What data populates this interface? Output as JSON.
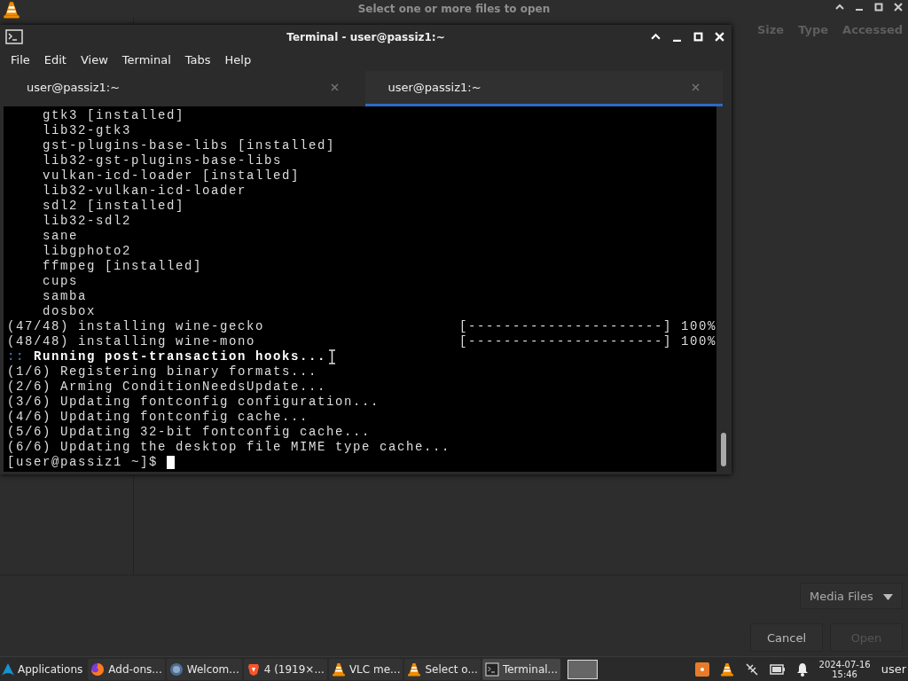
{
  "dialog": {
    "title": "Select one or more files to open",
    "columns": [
      "Size",
      "Type",
      "Accessed"
    ],
    "filter": "Media Files",
    "buttons": [
      {
        "label": "Cancel",
        "disabled": false
      },
      {
        "label": "Open",
        "disabled": true
      }
    ]
  },
  "terminal": {
    "title": "Terminal - user@passiz1:~",
    "menu": [
      "File",
      "Edit",
      "View",
      "Terminal",
      "Tabs",
      "Help"
    ],
    "tabs": [
      {
        "label": "user@passiz1:~",
        "selected": false
      },
      {
        "label": "user@passiz1:~",
        "selected": true
      }
    ],
    "lines": [
      {
        "kind": "item",
        "text": "gtk3 [installed]"
      },
      {
        "kind": "item",
        "text": "lib32-gtk3"
      },
      {
        "kind": "item",
        "text": "gst-plugins-base-libs [installed]"
      },
      {
        "kind": "item",
        "text": "lib32-gst-plugins-base-libs"
      },
      {
        "kind": "item",
        "text": "vulkan-icd-loader [installed]"
      },
      {
        "kind": "item",
        "text": "lib32-vulkan-icd-loader"
      },
      {
        "kind": "item",
        "text": "sdl2 [installed]"
      },
      {
        "kind": "item",
        "text": "lib32-sdl2"
      },
      {
        "kind": "item",
        "text": "sane"
      },
      {
        "kind": "item",
        "text": "libgphoto2"
      },
      {
        "kind": "item",
        "text": "ffmpeg [installed]"
      },
      {
        "kind": "item",
        "text": "cups"
      },
      {
        "kind": "item",
        "text": "samba"
      },
      {
        "kind": "item",
        "text": "dosbox"
      },
      {
        "kind": "progress",
        "text": "(47/48) installing wine-gecko",
        "bar": "[----------------------]",
        "percent": "100%"
      },
      {
        "kind": "progress",
        "text": "(48/48) installing wine-mono",
        "bar": "[----------------------]",
        "percent": "100%"
      },
      {
        "kind": "hook",
        "prefix": "::",
        "text": "Running post-transaction hooks..."
      },
      {
        "kind": "text",
        "text": "(1/6) Registering binary formats..."
      },
      {
        "kind": "text",
        "text": "(2/6) Arming ConditionNeedsUpdate..."
      },
      {
        "kind": "text",
        "text": "(3/6) Updating fontconfig configuration..."
      },
      {
        "kind": "text",
        "text": "(4/6) Updating fontconfig cache..."
      },
      {
        "kind": "text",
        "text": "(5/6) Updating 32-bit fontconfig cache..."
      },
      {
        "kind": "text",
        "text": "(6/6) Updating the desktop file MIME type cache..."
      },
      {
        "kind": "prompt",
        "text": "[user@passiz1 ~]$"
      }
    ]
  },
  "taskbar": {
    "menu": "Applications",
    "tasks": [
      {
        "kind": "fox",
        "label": "Add-ons...",
        "selected": false
      },
      {
        "kind": "globe",
        "label": "Welcom...",
        "selected": false
      },
      {
        "kind": "shield",
        "label": "4 (1919×...",
        "selected": false
      },
      {
        "kind": "cone",
        "label": "VLC me...",
        "selected": false
      },
      {
        "kind": "cone",
        "label": "Select o...",
        "selected": false
      },
      {
        "kind": "terminal",
        "label": "Terminal...",
        "selected": true
      }
    ],
    "date": "2024-07-16",
    "time": "15:46",
    "user": "user"
  }
}
